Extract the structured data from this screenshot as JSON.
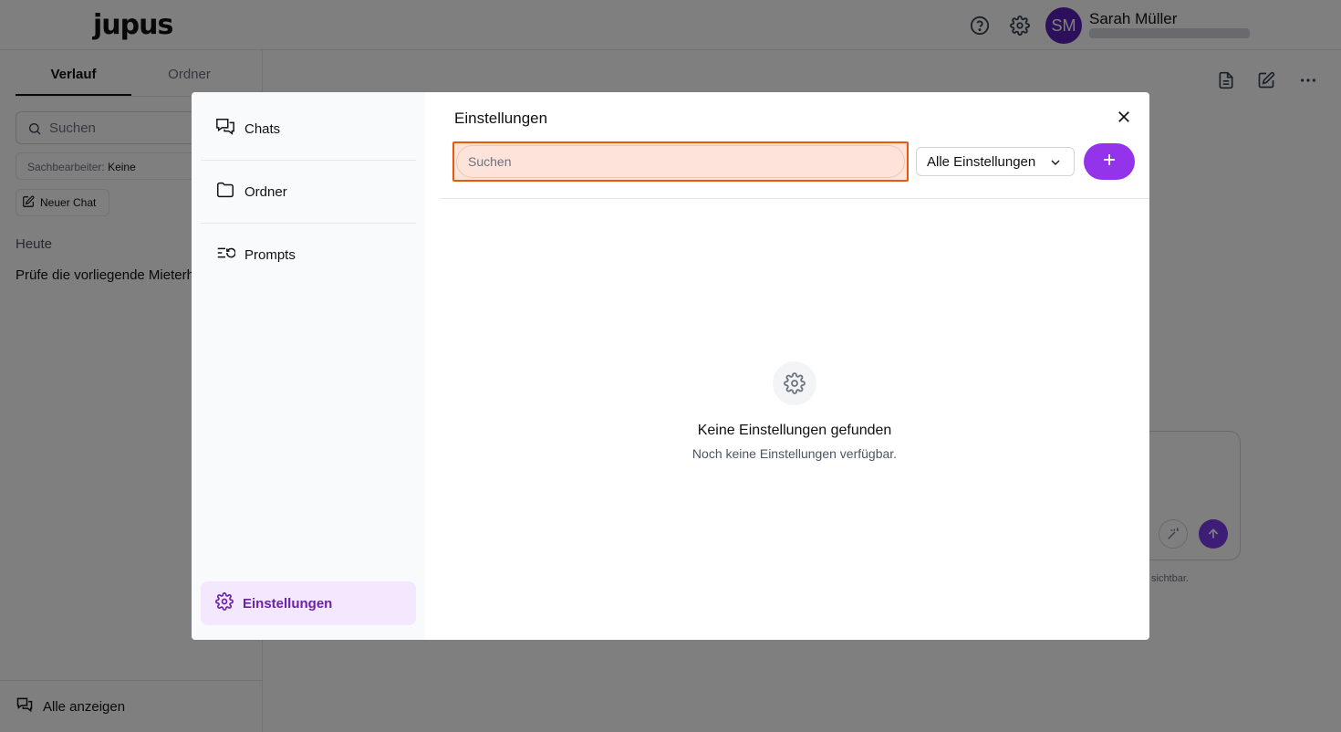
{
  "app": {
    "logo": "jupus",
    "user": {
      "initials": "SM",
      "name": "Sarah Müller"
    }
  },
  "sidebar": {
    "tabs": [
      {
        "label": "Verlauf",
        "active": true
      },
      {
        "label": "Ordner",
        "active": false
      }
    ],
    "search_placeholder": "Suchen",
    "filter_label": "Sachbearbeiter:",
    "filter_value": "Keine",
    "new_chat_label": "Neuer Chat",
    "section_label": "Heute",
    "items": [
      {
        "label": "Prüfe die vorliegende Mieterh"
      }
    ],
    "show_all_label": "Alle anzeigen"
  },
  "main": {
    "disclaimer_fragment": "sichtbar."
  },
  "modal": {
    "nav": [
      {
        "label": "Chats",
        "icon": "chats-icon",
        "active": false
      },
      {
        "label": "Ordner",
        "icon": "folder-icon",
        "active": false
      },
      {
        "label": "Prompts",
        "icon": "prompts-icon",
        "active": false
      }
    ],
    "nav_bottom": {
      "label": "Einstellungen",
      "icon": "gear-icon",
      "active": true
    },
    "title": "Einstellungen",
    "search_placeholder": "Suchen",
    "search_value": "",
    "filter_select": {
      "selected": "Alle Einstellungen"
    },
    "empty_state": {
      "title": "Keine Einstellungen gefunden",
      "subtitle": "Noch keine Einstellungen verfügbar."
    }
  },
  "colors": {
    "accent": "#9333ea",
    "active_nav_bg": "#f3e8ff",
    "focus_border": "#ea580c",
    "focus_fill": "#fde3d9",
    "avatar": "#5b21b6"
  }
}
